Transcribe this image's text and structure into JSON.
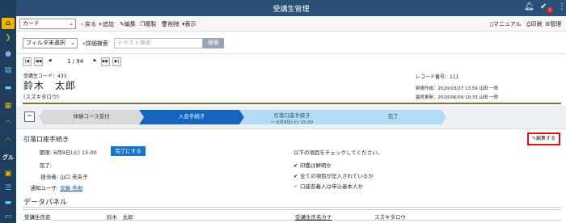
{
  "app": {
    "title": "受講生管理",
    "notification_badge": "3",
    "colors": {
      "topbar": "#2a4f78",
      "sidebar": "#1f3d5c",
      "primary": "#1565c0",
      "highlight": "#e01010"
    }
  },
  "sidebar": {
    "icons": [
      "home-icon",
      "expand-icon",
      "person-icon",
      "document-icon",
      "chat-icon",
      "building-icon",
      "headset-icon",
      "headset-icon",
      "group-icon",
      "calendar-icon",
      "list-icon",
      "chat-icon",
      "card-icon"
    ],
    "group_label": "グル"
  },
  "toolbar": {
    "view_select": "カード",
    "back": "戻る",
    "add": "追加",
    "edit": "編集",
    "copy": "複製",
    "delete": "削除",
    "display": "表示",
    "manual": "マニュアル",
    "print": "印刷",
    "admin": "管理"
  },
  "filter": {
    "select": "フィルタ未選択",
    "detail_search": "詳細検索",
    "text_placeholder": "テキスト検索",
    "search_button": "検索"
  },
  "pager": {
    "position": "1 / 94"
  },
  "record": {
    "student_code": "受講生コード：433",
    "name": "鈴木　太郎",
    "kana": "(スズキタロウ)",
    "record_number": "レコード番号：111",
    "created": "新規作成：2020/03/27 13:59 山田 一郎",
    "updated": "最終更新：2020/06/09 10:33 山田 一郎"
  },
  "stages": {
    "s1": "体験コース受付",
    "s2": "入会手続き",
    "s3": "引落口座手続き",
    "s3_sub": "～ 6月9日(火) 15:00",
    "s4": "完了"
  },
  "section": {
    "title": "引落口座手続き",
    "edit_button": "編集する",
    "due_label": "期限:",
    "due_value": "6月9日(火) 15:00",
    "complete_button": "完了にする",
    "done_label": "完了:",
    "assignee_label": "担当者:",
    "assignee_value": "山口 未央子",
    "notify_label": "通知ユーザ:",
    "notify_value": "安藤 秀樹",
    "check_heading": "以下の項目をチェックしてください。",
    "checks": [
      {
        "text": "印鑑は鮮明か",
        "checked": true
      },
      {
        "text": "全ての項目が記入されているか",
        "checked": true
      },
      {
        "text": "口座名義人は申込者本人か",
        "checked": false
      }
    ]
  },
  "data_panel": {
    "title": "データパネル",
    "name_label": "受講生氏名",
    "name_value": "鈴木　太郎",
    "kana_label": "受講生氏名カナ",
    "kana_value": "スズキタロウ"
  }
}
